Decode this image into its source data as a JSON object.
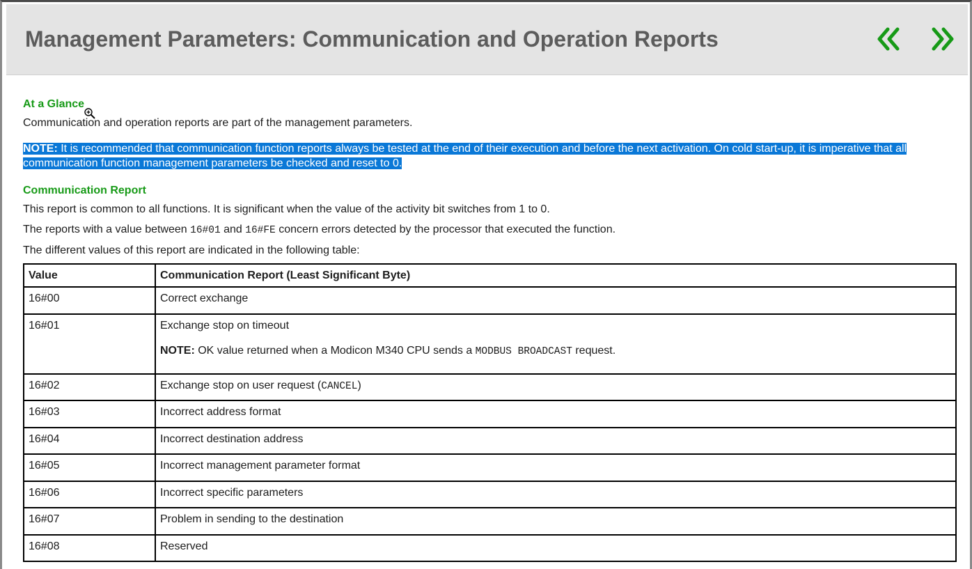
{
  "header": {
    "title": "Management Parameters: Communication and Operation Reports",
    "prev_icon": "double-chevron-left",
    "next_icon": "double-chevron-right",
    "accent_color": "#179a17"
  },
  "at_a_glance": {
    "heading": "At a Glance",
    "intro": "Communication and operation reports are part of the management parameters.",
    "note_label": "NOTE:",
    "note_line1": " It is recommended that communication function reports always be tested at the end of their execution and before the next activation. On cold start-up, it is imperative that all",
    "note_line2": "communication function management parameters be checked and reset to 0. ",
    "selection_color": "#0a78d7"
  },
  "communication_report": {
    "heading": "Communication Report",
    "para1": "This report is common to all functions. It is significant when the value of the activity bit switches from 1 to 0.",
    "para2_a": "The reports with a value between ",
    "para2_code1": "16#01",
    "para2_b": " and ",
    "para2_code2": "16#FE",
    "para2_c": " concern errors detected by the processor that executed the function.",
    "para3": "The different values of this report are indicated in the following table:"
  },
  "table": {
    "headers": [
      "Value",
      "Communication Report (Least Significant Byte)"
    ],
    "rows": [
      {
        "value": "16#00",
        "text": "Correct exchange"
      },
      {
        "value": "16#01",
        "text": "Exchange stop on timeout",
        "note_label": "NOTE:",
        "note_a": " OK value returned when a Modicon M340 CPU sends a ",
        "note_code": "MODBUS BROADCAST",
        "note_b": " request."
      },
      {
        "value": "16#02",
        "text_a": "Exchange stop on user request (",
        "text_code": "CANCEL",
        "text_b": ")"
      },
      {
        "value": "16#03",
        "text": "Incorrect address format"
      },
      {
        "value": "16#04",
        "text": "Incorrect destination address"
      },
      {
        "value": "16#05",
        "text": "Incorrect management parameter format"
      },
      {
        "value": "16#06",
        "text": "Incorrect specific parameters"
      },
      {
        "value": "16#07",
        "text": "Problem in sending to the destination"
      },
      {
        "value": "16#08",
        "text": "Reserved"
      }
    ]
  }
}
